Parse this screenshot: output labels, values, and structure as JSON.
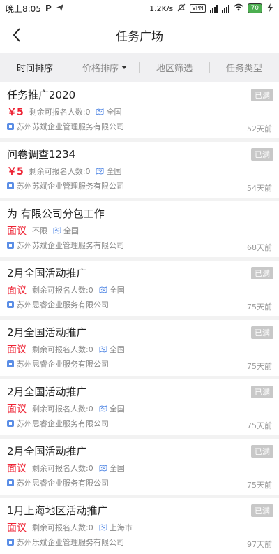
{
  "status": {
    "time": "晚上8:05",
    "speed": "1.2K/s",
    "vpn": "VPN",
    "battery": "70"
  },
  "nav": {
    "title": "任务广场"
  },
  "filters": [
    {
      "label": "时间排序"
    },
    {
      "label": "价格排序"
    },
    {
      "label": "地区筛选"
    },
    {
      "label": "任务类型"
    }
  ],
  "tasks": [
    {
      "title": "任务推广2020",
      "badge": "已满",
      "price": "￥5",
      "quota": "剩余可报名人数:0",
      "region": "全国",
      "company": "苏州苏斌企业管理服务有限公司",
      "days": "52天前"
    },
    {
      "title": "问卷调查1234",
      "badge": "已满",
      "price": "￥5",
      "quota": "剩余可报名人数:0",
      "region": "全国",
      "company": "苏州苏斌企业管理服务有限公司",
      "days": "54天前"
    },
    {
      "title": "为          有限公司分包工作",
      "badge": "",
      "price": "面议",
      "quota": "不限",
      "region": "全国",
      "company": "苏州苏斌企业管理服务有限公司",
      "days": "68天前"
    },
    {
      "title": "2月全国活动推广",
      "badge": "已满",
      "price": "面议",
      "quota": "剩余可报名人数:0",
      "region": "全国",
      "company": "苏州思睿企业服务有限公司",
      "days": "75天前"
    },
    {
      "title": "2月全国活动推广",
      "badge": "已满",
      "price": "面议",
      "quota": "剩余可报名人数:0",
      "region": "全国",
      "company": "苏州思睿企业服务有限公司",
      "days": "75天前"
    },
    {
      "title": "2月全国活动推广",
      "badge": "已满",
      "price": "面议",
      "quota": "剩余可报名人数:0",
      "region": "全国",
      "company": "苏州思睿企业服务有限公司",
      "days": "75天前"
    },
    {
      "title": "2月全国活动推广",
      "badge": "已满",
      "price": "面议",
      "quota": "剩余可报名人数:0",
      "region": "全国",
      "company": "苏州思睿企业服务有限公司",
      "days": "75天前"
    },
    {
      "title": "1月上海地区活动推广",
      "badge": "已满",
      "price": "面议",
      "quota": "剩余可报名人数:0",
      "region": "上海市",
      "company": "苏州乐斌企业管理服务有限公司",
      "days": "97天前"
    }
  ]
}
